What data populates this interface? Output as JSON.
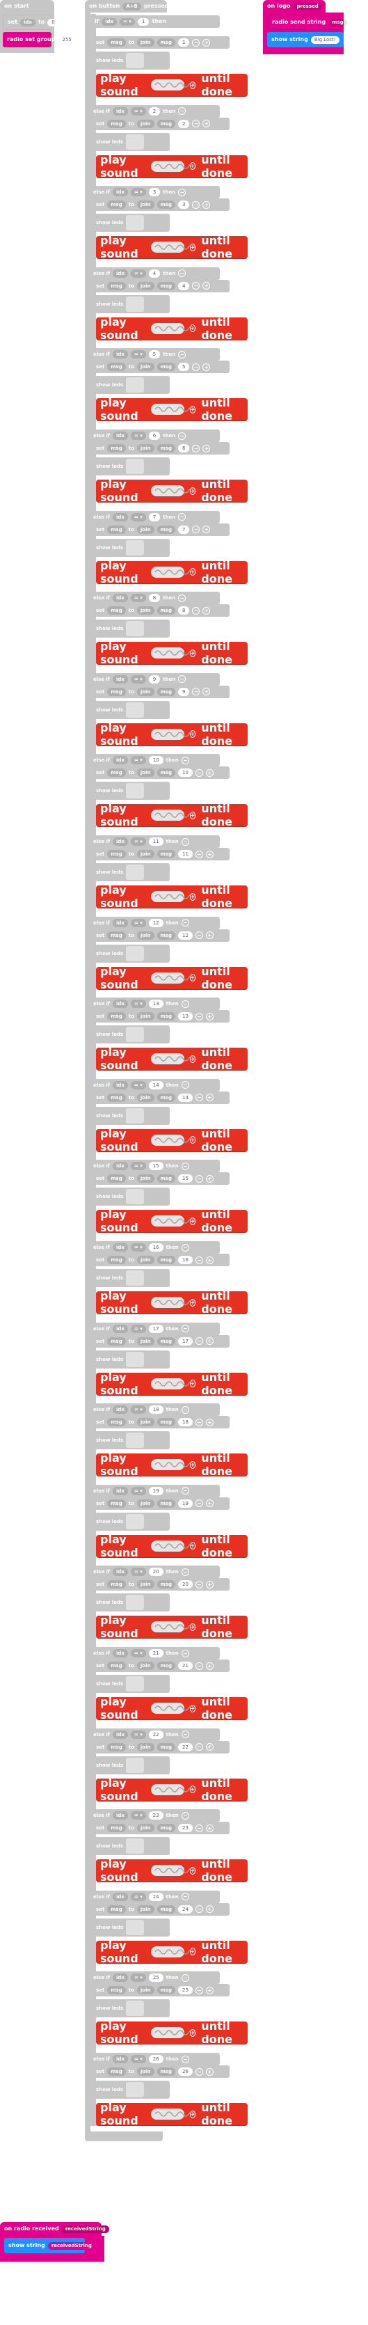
{
  "on_start": {
    "title": "on start",
    "set_label": "set",
    "set_var": "idx",
    "set_to": "to",
    "set_value": "0",
    "radio_group_label": "radio set group",
    "radio_group_value": "255"
  },
  "on_button": {
    "title": "on button",
    "button": "A+B",
    "pressed": "pressed",
    "if_label": "if",
    "idx": "idx",
    "op": "= ▾",
    "then": "then",
    "show_leds": "show leds",
    "set_label": "set",
    "msg": "msg",
    "to": "to",
    "join": "join",
    "play_sound": "play sound",
    "until_done": "until done",
    "else_if": "else if"
  },
  "cases": [
    "1",
    "2",
    "3",
    "4",
    "5",
    "6",
    "7",
    "8",
    "9",
    "10",
    "11",
    "12",
    "13",
    "14",
    "15",
    "16",
    "17",
    "18",
    "19",
    "20",
    "21",
    "22",
    "23",
    "24",
    "25",
    "26"
  ],
  "msgs": [
    "1",
    "2",
    "3",
    "4",
    "5",
    "6",
    "7",
    "8",
    "9",
    "10",
    "11",
    "12",
    "13",
    "14",
    "15",
    "16",
    "17",
    "18",
    "19",
    "20",
    "21",
    "22",
    "23",
    "24",
    "25",
    "26"
  ],
  "on_logo": {
    "title": "on logo",
    "state": "pressed",
    "radio_send": "radio send string",
    "msg": "msg",
    "show_string": "show string",
    "value": "Big Lost!"
  },
  "on_radio": {
    "title": "on radio received",
    "param": "receivedString",
    "show_string": "show string",
    "value": "receivedString"
  },
  "colors": {
    "grey": "#c6c6c6",
    "purple": "#e3008c",
    "blue": "#1e90ff",
    "red": "#e63022"
  }
}
